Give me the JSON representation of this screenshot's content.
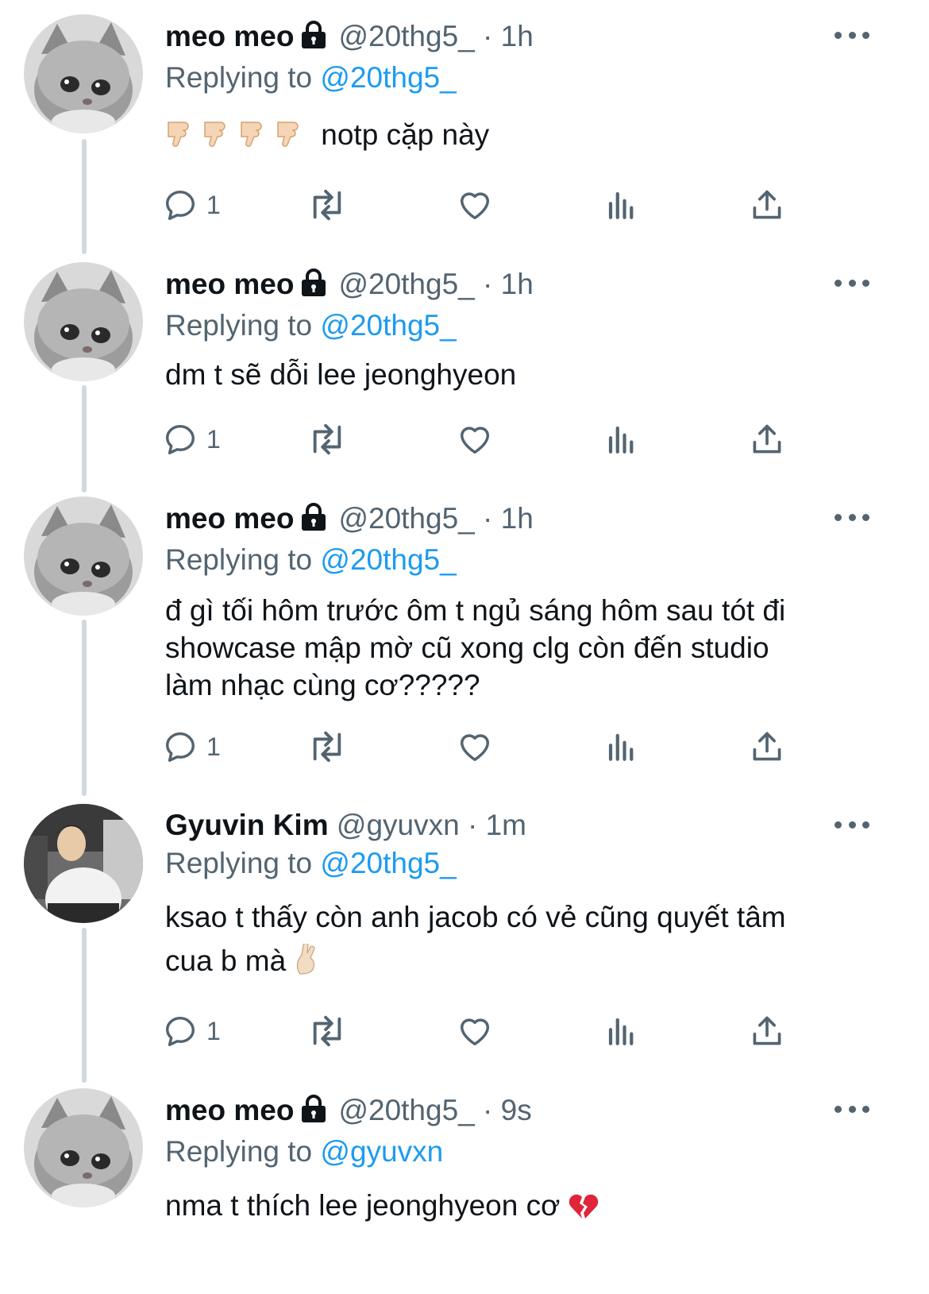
{
  "colors": {
    "accent": "#1d9bf0",
    "muted": "#536471",
    "text": "#0f1419",
    "thread": "#cfd9de"
  },
  "tweets": [
    {
      "name": "meo meo",
      "locked": true,
      "handle": "@20thg5_",
      "sep": "·",
      "time": "1h",
      "reply_prefix": "Replying to",
      "reply_to": "@20thg5_",
      "text": "notp cặp này",
      "emoji_prefix": "thumbs-down x4",
      "reply_count": "1",
      "avatar": "cat-avatar"
    },
    {
      "name": "meo meo",
      "locked": true,
      "handle": "@20thg5_",
      "sep": "·",
      "time": "1h",
      "reply_prefix": "Replying to",
      "reply_to": "@20thg5_",
      "text": "dm t sẽ dỗi lee jeonghyeon",
      "reply_count": "1",
      "avatar": "cat-avatar"
    },
    {
      "name": "meo meo",
      "locked": true,
      "handle": "@20thg5_",
      "sep": "·",
      "time": "1h",
      "reply_prefix": "Replying to",
      "reply_to": "@20thg5_",
      "text_lines": [
        "đ gì tối hôm trước ôm t ngủ sáng hôm sau tót đi",
        "showcase mập mờ cũ xong clg còn đến studio",
        "làm nhạc cùng cơ?????"
      ],
      "reply_count": "1",
      "avatar": "cat-avatar"
    },
    {
      "name": "Gyuvin Kim",
      "locked": false,
      "handle": "@gyuvxn",
      "sep": "·",
      "time": "1m",
      "reply_prefix": "Replying to",
      "reply_to": "@20thg5_",
      "text_lines": [
        "ksao t thấy còn anh jacob có vẻ cũng quyết tâm",
        "cua b mà"
      ],
      "text_emoji": "crossed-fingers",
      "reply_count": "1",
      "avatar": "person-avatar"
    },
    {
      "name": "meo meo",
      "locked": true,
      "handle": "@20thg5_",
      "sep": "·",
      "time": "9s",
      "reply_prefix": "Replying to",
      "reply_to": "@gyuvxn",
      "text": "nma t thích lee jeonghyeon cơ",
      "text_emoji": "broken-heart",
      "avatar": "cat-avatar"
    }
  ]
}
